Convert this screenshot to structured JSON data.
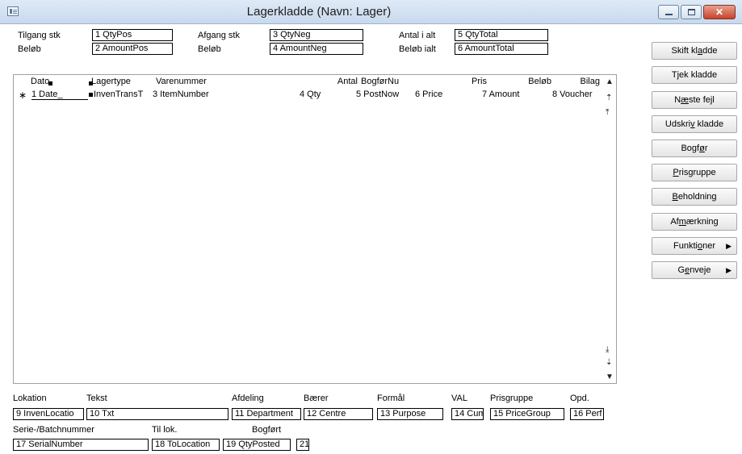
{
  "window": {
    "title": "Lagerkladde (Navn: Lager)",
    "minimize_icon": "minimize-icon",
    "maximize_icon": "maximize-icon",
    "close_icon": "close-icon",
    "close_glyph": "✕"
  },
  "header": {
    "tilgang_label": "Tilgang stk",
    "tilgang_value": "1  QtyPos",
    "belob1_label": "Beløb",
    "belob1_value": "2  AmountPos",
    "afgang_label": "Afgang stk",
    "afgang_value": "3  QtyNeg",
    "belob2_label": "Beløb",
    "belob2_value": "4  AmountNeg",
    "antal_label": "Antal i alt",
    "antal_value": "5  QtyTotal",
    "belobialt_label": "Beløb ialt",
    "belobialt_value": "6  AmountTotal"
  },
  "grid": {
    "columns": [
      "Dato",
      "Lagertype",
      "Varenummer",
      "Antal",
      "BogførNu",
      "Pris",
      "Beløb",
      "Bilag"
    ],
    "row_marker": "∗",
    "row": [
      "1  Date_",
      "InvenTransT",
      "3  ItemNumber",
      "4  Qty",
      "5  PostNow",
      "6  Price",
      "7  Amount",
      "8  Voucher"
    ]
  },
  "scrollbar": {
    "up": "▲",
    "step_up": "⇡",
    "top": "⤒",
    "bottom": "⤓",
    "step_down": "⇣",
    "down": "▼"
  },
  "sidebar": {
    "buttons": [
      {
        "pre": "Skift kl",
        "u": "a",
        "post": "dde"
      },
      {
        "pre": "T",
        "u": "j",
        "post": "ek kladde"
      },
      {
        "pre": "N",
        "u": "æ",
        "post": "ste fejl"
      },
      {
        "pre": "Udskri",
        "u": "v",
        "post": " kladde"
      },
      {
        "pre": "Bogf",
        "u": "ø",
        "post": "r"
      },
      {
        "pre": "",
        "u": "P",
        "post": "risgruppe"
      },
      {
        "pre": "",
        "u": "B",
        "post": "eholdning"
      },
      {
        "pre": "Af",
        "u": "m",
        "post": "ærkning"
      },
      {
        "pre": "Funkti",
        "u": "o",
        "post": "ner"
      },
      {
        "pre": "G",
        "u": "e",
        "post": "nveje"
      }
    ],
    "submenu_arrow": "▶"
  },
  "footer": {
    "lokation_label": "Lokation",
    "lokation_value": "9  InvenLocatio",
    "tekst_label": "Tekst",
    "tekst_value": "10  Txt",
    "afdeling_label": "Afdeling",
    "afdeling_value": "11 Department",
    "baerer_label": "Bærer",
    "baerer_value": "12 Centre",
    "formal_label": "Formål",
    "formal_value": "13 Purpose",
    "val_label": "VAL",
    "val_value": "14 Cum",
    "prisgruppe_label": "Prisgruppe",
    "prisgruppe_value": "15 PriceGroup",
    "opd_label": "Opd.",
    "opd_value": "16 Perf",
    "serie_label": "Serie-/Batchnummer",
    "serie_value": "17 SerialNumber",
    "tillok_label": "Til lok.",
    "tillok_value": "18 ToLocation",
    "bogfort_label": "Bogført",
    "bogfort_value": "19 QtyPosted",
    "f21_value": "21"
  }
}
